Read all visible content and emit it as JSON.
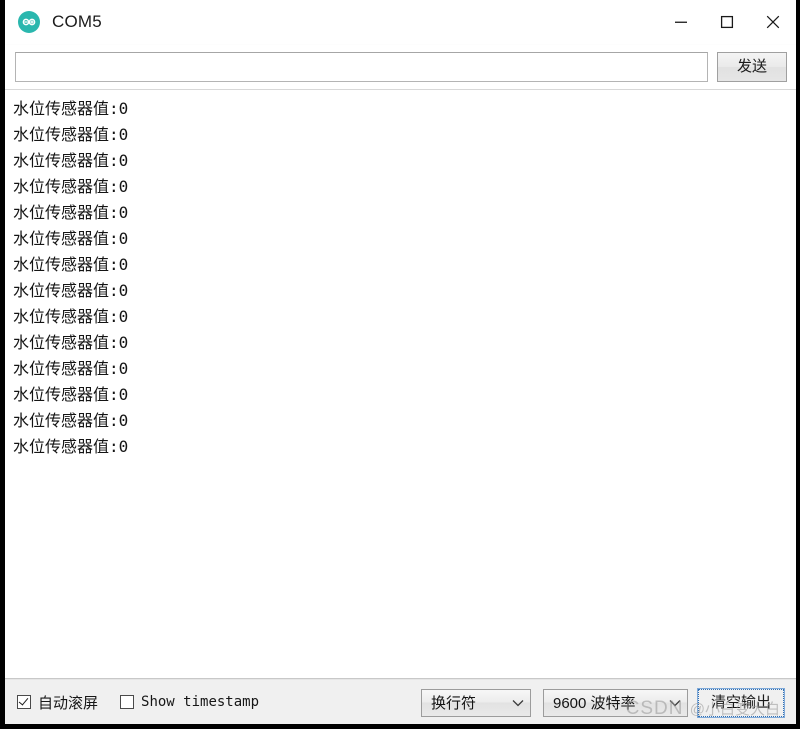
{
  "window": {
    "title": "COM5",
    "app_icon": "arduino-infinity-icon",
    "controls": {
      "minimize_label": "—",
      "maximize_label": "□",
      "close_label": "✕"
    }
  },
  "send_row": {
    "input_value": "",
    "input_placeholder": "",
    "send_label": "发送"
  },
  "console": {
    "lines": [
      "水位传感器值:0",
      "水位传感器值:0",
      "水位传感器值:0",
      "水位传感器值:0",
      "水位传感器值:0",
      "水位传感器值:0",
      "水位传感器值:0",
      "水位传感器值:0",
      "水位传感器值:0",
      "水位传感器值:0",
      "水位传感器值:0",
      "水位传感器值:0",
      "水位传感器值:0",
      "水位传感器值:0"
    ]
  },
  "bottom_bar": {
    "autoscroll": {
      "label": "自动滚屏",
      "checked": true
    },
    "show_timestamp": {
      "label": "Show timestamp",
      "checked": false
    },
    "line_ending": {
      "selected": "换行符"
    },
    "baud_rate": {
      "selected": "9600 波特率"
    },
    "clear_output_label": "清空输出"
  },
  "watermark": {
    "brand": "CSDN",
    "handle": "@小白变大白"
  },
  "colors": {
    "accent": "#2ab7ae",
    "focus_border": "#2f6fb5",
    "window_border": "#000000",
    "bottom_bar_bg": "#f0f0f0",
    "text": "#141414"
  }
}
